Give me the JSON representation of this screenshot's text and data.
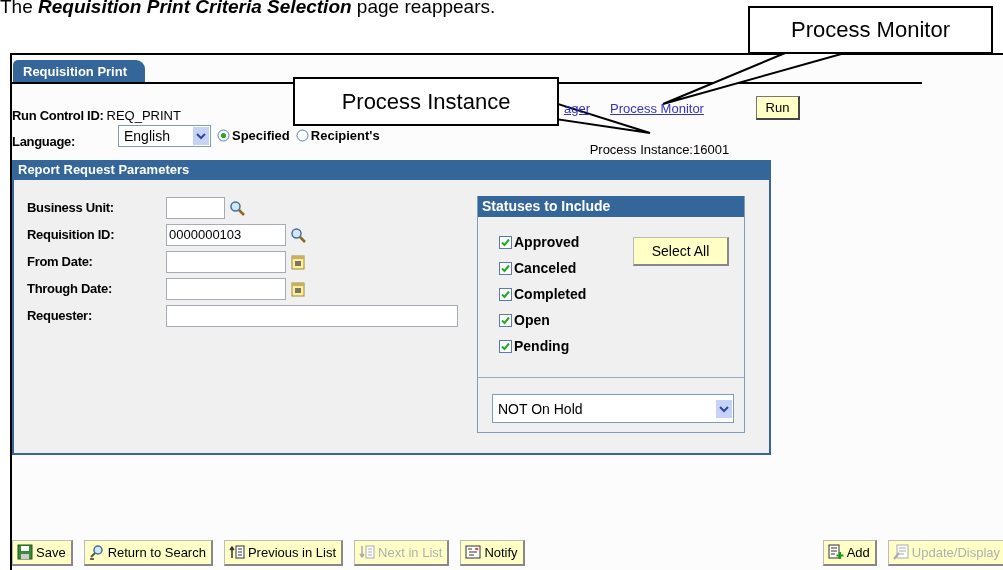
{
  "caption": "The **Requisition Print Criteria Selection** page reappears.",
  "tabs": [
    {
      "label": "Requisition Print",
      "selected": true
    }
  ],
  "run_control": {
    "label": "Run Control ID:",
    "value": "REQ_PRINT"
  },
  "language": {
    "label": "Language:",
    "value": "English"
  },
  "language_options": [
    {
      "label": "Specified",
      "selected": true
    },
    {
      "label": "Recipient's",
      "selected": false
    }
  ],
  "links": [
    {
      "label": "ager"
    },
    {
      "label": "Process Monitor"
    }
  ],
  "run_button": "Run",
  "process_instance": "Process Instance:16001",
  "parameters": {
    "title": "Report Request Parameters",
    "fields": [
      {
        "label": "Business Unit:",
        "kind": "lookup"
      },
      {
        "label": "Requisition ID:",
        "kind": "lookup",
        "value": "0000000103"
      },
      {
        "label": "From Date:",
        "kind": "date"
      },
      {
        "label": "Through Date:",
        "kind": "date"
      },
      {
        "label": "Requester:",
        "kind": "text"
      }
    ]
  },
  "statuses": {
    "title": "Statuses to Include",
    "select_all": "Select All",
    "hold_filter": "NOT On Hold",
    "items": [
      {
        "label": "Approved",
        "checked": true
      },
      {
        "label": "Canceled",
        "checked": true
      },
      {
        "label": "Completed",
        "checked": true
      },
      {
        "label": "Open",
        "checked": true
      },
      {
        "label": "Pending",
        "checked": true
      }
    ]
  },
  "toolbar": [
    {
      "label": "Save",
      "kind": "save",
      "disabled": false
    },
    {
      "label": "Return to Search",
      "kind": "search",
      "disabled": false
    },
    {
      "label": "Previous in List",
      "kind": "previous",
      "disabled": false
    },
    {
      "label": "Next in List",
      "kind": "next",
      "disabled": true
    },
    {
      "label": "Notify",
      "kind": "notify",
      "disabled": false
    },
    {
      "label": "Add",
      "kind": "add",
      "disabled": false
    },
    {
      "label": "Update/Display",
      "kind": "update",
      "disabled": true
    }
  ],
  "callouts": [
    {
      "text": "Process Monitor",
      "kind": "monitor"
    },
    {
      "text": "Process Instance",
      "kind": "instance"
    }
  ]
}
